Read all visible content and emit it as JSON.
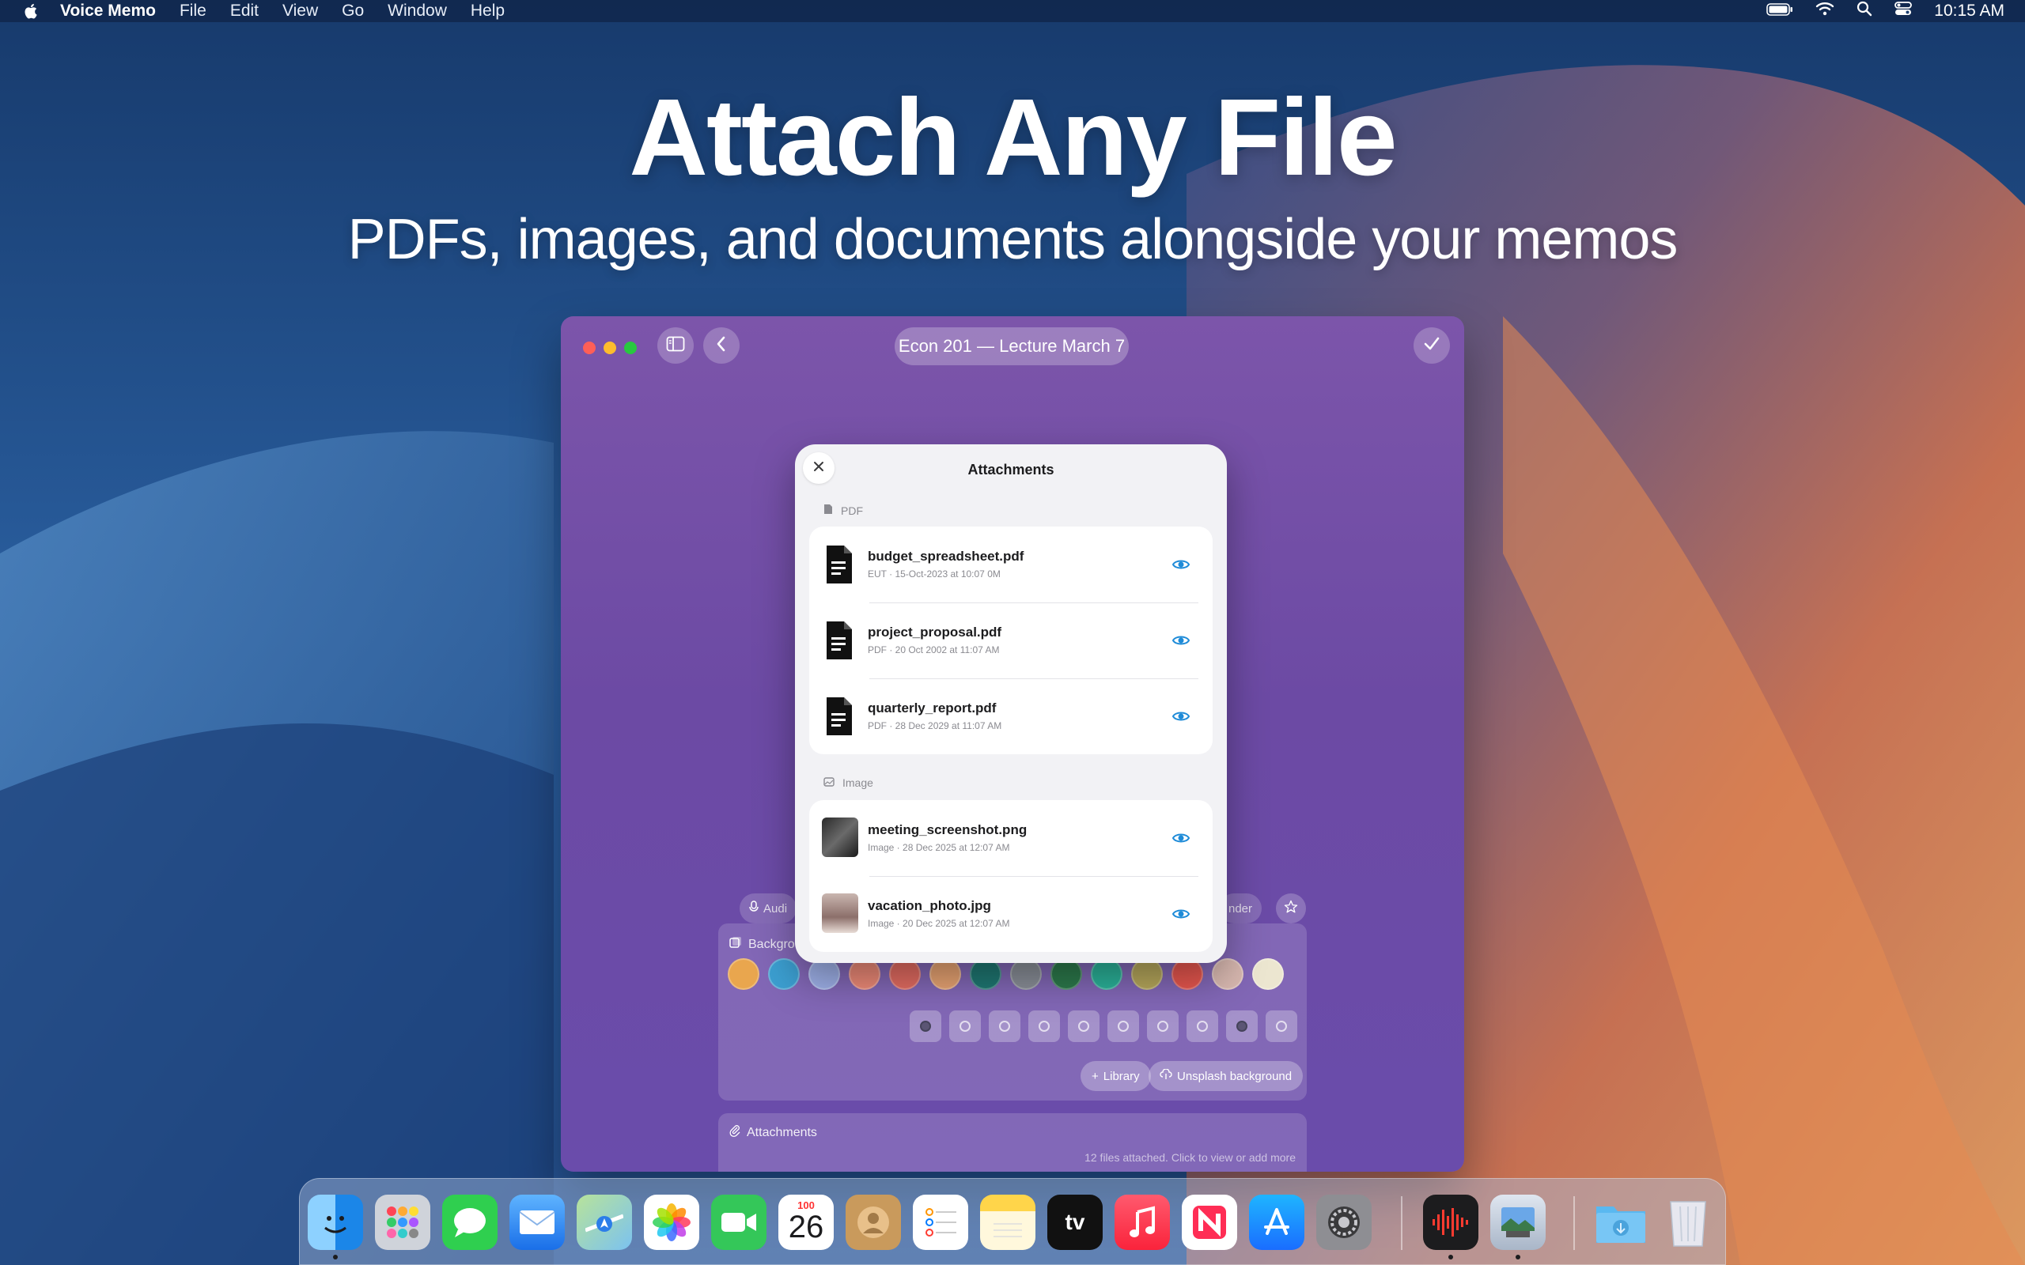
{
  "menubar": {
    "app_name": "Voice Memo",
    "menus": [
      "File",
      "Edit",
      "View",
      "Go",
      "Window",
      "Help"
    ],
    "clock": "10:15 AM"
  },
  "hero": {
    "title": "Attach Any File",
    "subtitle": "PDFs, images, and documents alongside your memos"
  },
  "window": {
    "title": "Econ 201 — Lecture March 7",
    "toolbar_left_label": "Audi",
    "toolbar_right_label": "nder",
    "background_label": "Backgro",
    "swatch_colors": [
      "#e9a64e",
      "#3c9fd1",
      "#9eb0e8",
      "#ee8a78",
      "#e46c62",
      "#e9a473",
      "#1f7873",
      "#8a8f98",
      "#2c7a4c",
      "#2bb39a",
      "#b7a85c",
      "#e8574f",
      "#d8b8b0",
      "#ece6d0"
    ],
    "library_label": "Library",
    "unsplash_label": "Unsplash background",
    "attachments_label": "Attachments",
    "attachments_hint": "12 files attached. Click to view or add more"
  },
  "sheet": {
    "title": "Attachments",
    "sections": [
      {
        "name": "PDF",
        "items": [
          {
            "name": "budget_spreadsheet.pdf",
            "meta": "EUT  ·  15-Oct-2023 at 10:07 0M"
          },
          {
            "name": "project_proposal.pdf",
            "meta": "PDF  ·  20 Oct 2002 at 11:07 AM"
          },
          {
            "name": "quarterly_report.pdf",
            "meta": "PDF  ·  28 Dec 2029 at 11:07 AM"
          }
        ]
      },
      {
        "name": "Image",
        "items": [
          {
            "name": "meeting_screenshot.png",
            "meta": "Image  ·  28 Dec 2025 at 12:07 AM"
          },
          {
            "name": "vacation_photo.jpg",
            "meta": "Image  ·  20 Dec 2025 at 12:07 AM"
          }
        ]
      }
    ]
  },
  "dock": {
    "calendar_month": "100",
    "calendar_day": "26",
    "apps": [
      "finder-icon",
      "launchpad-icon",
      "messages-icon",
      "mail-icon",
      "maps-icon",
      "photos-icon",
      "facetime-icon",
      "calendar-icon",
      "contacts-icon",
      "reminders-icon",
      "notes-icon",
      "tv-icon",
      "music-icon",
      "news-icon",
      "app-store-icon",
      "system-settings-icon",
      "voice-memo-icon",
      "preview-icon",
      "downloads-folder-icon",
      "trash-icon"
    ]
  }
}
